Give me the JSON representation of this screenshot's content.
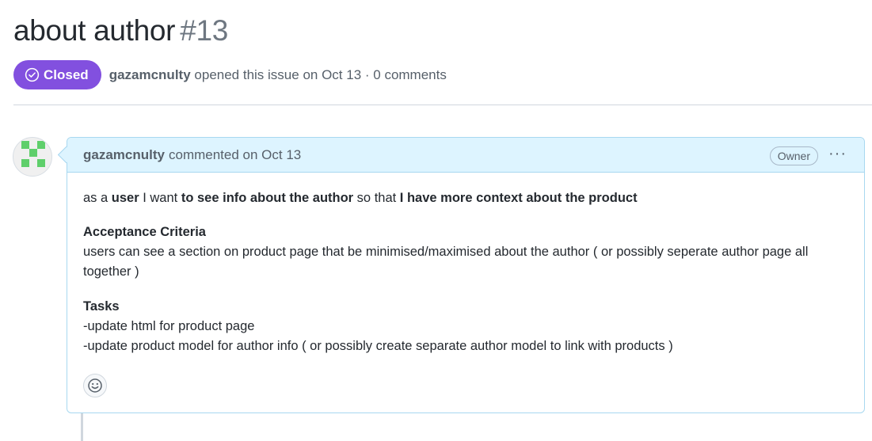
{
  "issue": {
    "title": "about author",
    "number": "#13",
    "state": "Closed",
    "author": "gazamcnulty",
    "meta_suffix": "opened this issue on Oct 13 · 0 comments"
  },
  "comment": {
    "author": "gazamcnulty",
    "action": "commented on Oct 13",
    "role_badge": "Owner",
    "menu_label": "···",
    "story": {
      "p1": "as a ",
      "b1": "user",
      "p2": " I want ",
      "b2": "to see info about the author",
      "p3": " so that ",
      "b3": "I have more context about the product"
    },
    "acceptance_heading": "Acceptance Criteria",
    "acceptance_text": "users can see a section on product page that be minimised/maximised about the author ( or possibly seperate author page all together )",
    "tasks_heading": "Tasks",
    "tasks": [
      "-update html for product page",
      "-update product model for author info ( or possibly create separate author model to link with products )"
    ]
  },
  "colors": {
    "closed_badge": "#8250df",
    "comment_header_bg": "#ddf4ff",
    "comment_border": "#a8d8f0",
    "avatar_green": "#5fcf6b"
  },
  "icons": {
    "state": "check-circle-icon",
    "reaction": "smiley-icon",
    "menu": "kebab-horizontal-icon"
  }
}
